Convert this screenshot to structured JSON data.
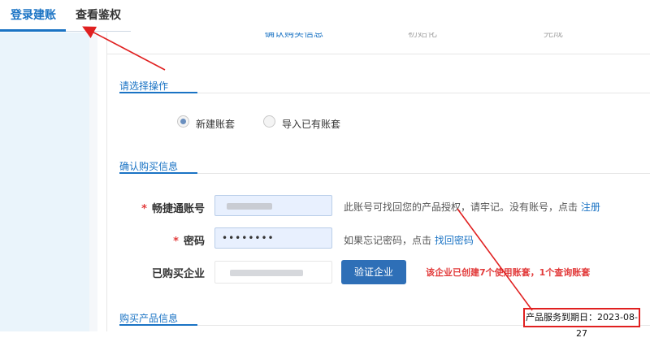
{
  "tabs": [
    {
      "label": "登录建账",
      "active": true
    },
    {
      "label": "查看鉴权",
      "active": false
    }
  ],
  "steps": [
    "确认购买信息",
    "初始化",
    "完成"
  ],
  "sections": {
    "operation": "请选择操作",
    "purchase_info": "确认购买信息",
    "product_info": "购买产品信息"
  },
  "radio_options": [
    {
      "label": "新建账套",
      "checked": true
    },
    {
      "label": "导入已有账套",
      "checked": false
    }
  ],
  "form": {
    "account_label": "畅捷通账号",
    "account_hint": "此账号可找回您的产品授权，请牢记。没有账号，点击",
    "register_link": "注册",
    "password_label": "密码",
    "password_value": "••••••••",
    "password_hint": "如果忘记密码，点击",
    "recover_link": "找回密码",
    "company_label": "已购买企业",
    "verify_button": "验证企业",
    "company_note": "该企业已创建7个使用账套，1个查询账套"
  },
  "service_expiry": "产品服务到期日：2023-08-27",
  "colors": {
    "accent": "#1a73c4",
    "annotation": "#e02020"
  }
}
